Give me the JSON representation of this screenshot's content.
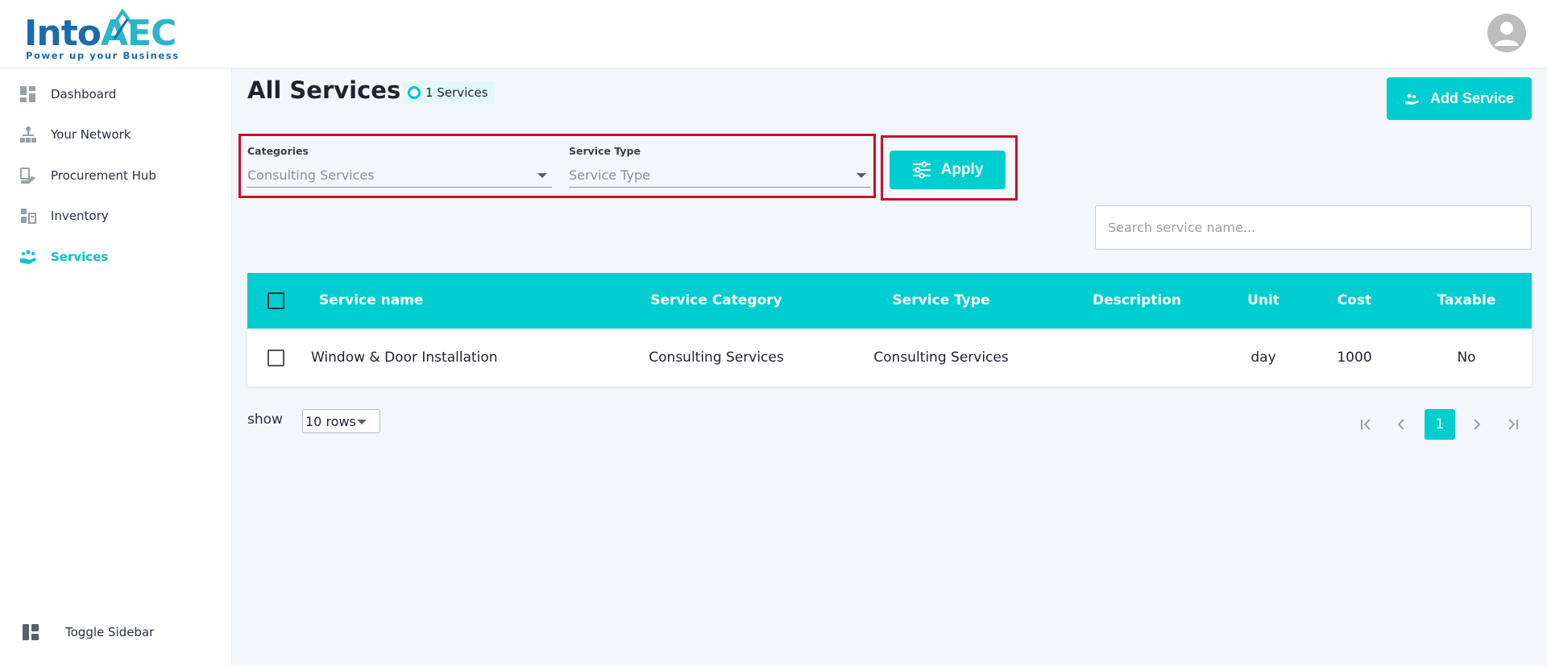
{
  "brand": {
    "name_part1": "Into",
    "name_part2": "AEC",
    "tagline": "Power up your Business"
  },
  "sidebar": {
    "items": [
      {
        "label": "Dashboard",
        "icon": "dashboard-icon",
        "active": false
      },
      {
        "label": "Your Network",
        "icon": "network-icon",
        "active": false
      },
      {
        "label": "Procurement Hub",
        "icon": "procurement-icon",
        "active": false
      },
      {
        "label": "Inventory",
        "icon": "inventory-icon",
        "active": false
      },
      {
        "label": "Services",
        "icon": "services-icon",
        "active": true
      }
    ],
    "toggle_label": "Toggle Sidebar"
  },
  "page": {
    "title": "All Services",
    "count_label": "1 Services",
    "add_button_label": "Add Service"
  },
  "filters": {
    "categories_label": "Categories",
    "categories_value": "Consulting Services",
    "service_type_label": "Service Type",
    "service_type_placeholder": "Service Type",
    "apply_label": "Apply"
  },
  "search": {
    "placeholder": "Search service name..."
  },
  "table": {
    "headers": [
      "Service name",
      "Service Category",
      "Service Type",
      "Description",
      "Unit",
      "Cost",
      "Taxable"
    ],
    "rows": [
      {
        "service_name": "Window & Door Installation",
        "service_category": "Consulting Services",
        "service_type": "Consulting Services",
        "description": "",
        "unit": "day",
        "cost": "1000",
        "taxable": "No"
      }
    ]
  },
  "pagination": {
    "show_label": "show",
    "rows_option": "10 rows",
    "current_page": "1"
  },
  "colors": {
    "accent": "#00cdcf",
    "brand_blue": "#1b6ab0",
    "highlight_border": "#c8102e"
  }
}
